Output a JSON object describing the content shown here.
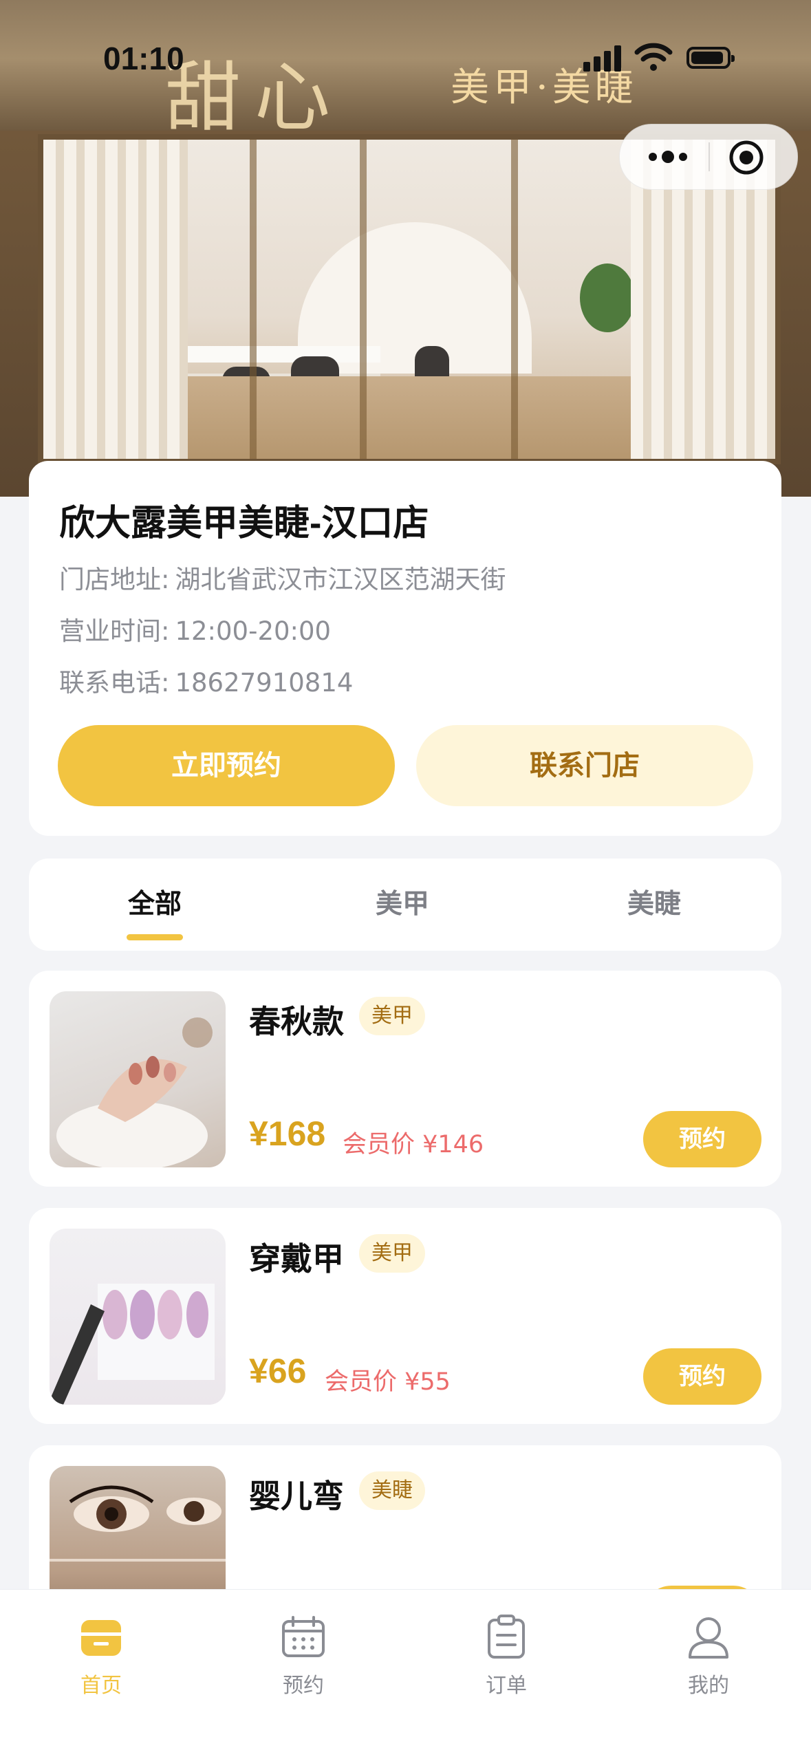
{
  "status_bar": {
    "time": "01:10"
  },
  "hero": {
    "sign_script": "甜心",
    "sign_text": "美甲·美睫"
  },
  "store": {
    "name": "欣大露美甲美睫-汉口店",
    "address_label": "门店地址:",
    "address": "湖北省武汉市江汉区范湖天街",
    "hours_label": "营业时间:",
    "hours": "12:00-20:00",
    "phone_label": "联系电话:",
    "phone": "18627910814",
    "book_button": "立即预约",
    "contact_button": "联系门店"
  },
  "tabs": [
    {
      "label": "全部",
      "active": true
    },
    {
      "label": "美甲",
      "active": false
    },
    {
      "label": "美睫",
      "active": false
    }
  ],
  "products": [
    {
      "name": "春秋款",
      "tag": "美甲",
      "price": "¥168",
      "member_price": "会员价 ¥146",
      "button": "预约"
    },
    {
      "name": "穿戴甲",
      "tag": "美甲",
      "price": "¥66",
      "member_price": "会员价 ¥55",
      "button": "预约"
    },
    {
      "name": "婴儿弯",
      "tag": "美睫",
      "price": "",
      "member_price": "",
      "button": ""
    }
  ],
  "tabbar": [
    {
      "label": "首页",
      "icon": "store-icon",
      "active": true
    },
    {
      "label": "预约",
      "icon": "calendar-icon",
      "active": false
    },
    {
      "label": "订单",
      "icon": "clipboard-icon",
      "active": false
    },
    {
      "label": "我的",
      "icon": "user-icon",
      "active": false
    }
  ],
  "colors": {
    "accent": "#f2c441",
    "accent_soft": "#fef5d9",
    "price": "#d9a31f",
    "member": "#ec6b6b"
  }
}
